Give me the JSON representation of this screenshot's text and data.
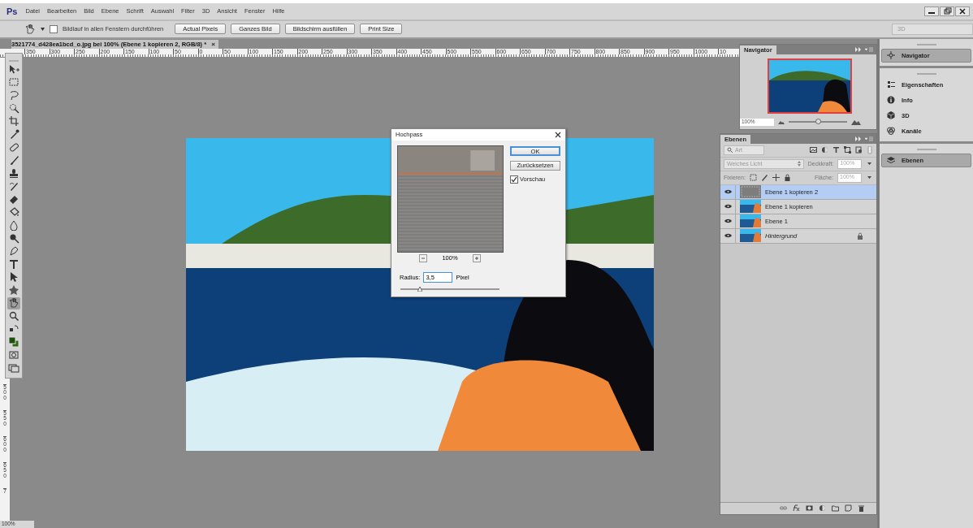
{
  "app": {
    "logo": "Ps"
  },
  "menu": [
    "Datei",
    "Bearbeiten",
    "Bild",
    "Ebene",
    "Schrift",
    "Auswahl",
    "Filter",
    "3D",
    "Ansicht",
    "Fenster",
    "Hilfe"
  ],
  "options_bar": {
    "scroll_all": {
      "label": "Bildlauf in allen Fenstern durchführen",
      "checked": false
    },
    "buttons": [
      "Actual Pixels",
      "Ganzes Bild",
      "Bildschirm ausfüllen",
      "Print Size"
    ],
    "workspace": "3D"
  },
  "document": {
    "tab_title": "3521774_d428ea1bcd_o.jpg bei 100% (Ebene 1 kopieren 2, RGB/8) *",
    "tab_close": "×"
  },
  "rulers": {
    "horizontal": [
      "350",
      "300",
      "250",
      "200",
      "150",
      "100",
      "50",
      "0",
      "50",
      "100",
      "150",
      "200",
      "250",
      "300",
      "350",
      "400",
      "450",
      "500",
      "550",
      "600",
      "650",
      "700",
      "750",
      "800",
      "850",
      "900",
      "950",
      "1000",
      "10"
    ],
    "vertical": [
      "500",
      "550",
      "600",
      "650",
      "7"
    ]
  },
  "tools": [
    {
      "kind": "move",
      "selected": false
    },
    {
      "kind": "marquee",
      "selected": false
    },
    {
      "kind": "lasso",
      "selected": false
    },
    {
      "kind": "quickselect",
      "selected": false
    },
    {
      "kind": "crop",
      "selected": false
    },
    {
      "kind": "eyedropper",
      "selected": false
    },
    {
      "kind": "healing",
      "selected": false
    },
    {
      "kind": "brush",
      "selected": false
    },
    {
      "kind": "stamp",
      "selected": false
    },
    {
      "kind": "history",
      "selected": false
    },
    {
      "kind": "eraser",
      "selected": false
    },
    {
      "kind": "bucket",
      "selected": false
    },
    {
      "kind": "blur",
      "selected": false
    },
    {
      "kind": "dodge",
      "selected": false
    },
    {
      "kind": "pen",
      "selected": false
    },
    {
      "kind": "type",
      "selected": false
    },
    {
      "kind": "pathselect",
      "selected": false
    },
    {
      "kind": "shape",
      "selected": false
    },
    {
      "kind": "hand",
      "selected": true
    },
    {
      "kind": "zoom",
      "selected": false
    },
    {
      "kind": "swap",
      "selected": false
    },
    {
      "kind": "colors",
      "selected": false
    },
    {
      "kind": "quickmask",
      "selected": false
    },
    {
      "kind": "screenmode",
      "selected": false
    }
  ],
  "dialog": {
    "title": "Hochpass",
    "zoom": "100%",
    "radius_label": "Radius:",
    "radius_value": "3,5",
    "radius_unit": "Pixel",
    "slider": {
      "level": 0.2
    },
    "buttons": [
      {
        "label": "OK",
        "default": true
      },
      {
        "label": "Zurücksetzen",
        "default": false
      }
    ],
    "preview": {
      "label": "Vorschau",
      "checked": true
    }
  },
  "navigator": {
    "title": "Navigator",
    "zoom": "100%",
    "slider": {
      "level": 0.5
    }
  },
  "layers_panel": {
    "title": "Ebenen",
    "filter": "Art",
    "blend_mode": "Weiches Licht",
    "opacity_label": "Deckkraft:",
    "opacity": "100%",
    "lock_label": "Fixieren:",
    "fill_label": "Fläche:",
    "fill": "100%",
    "layers": [
      {
        "name": "Ebene 1 kopieren 2",
        "kind": "filtered",
        "selected": true,
        "visible": true,
        "locked": false
      },
      {
        "name": "Ebene 1 kopieren",
        "kind": "layer",
        "selected": false,
        "visible": true,
        "locked": false
      },
      {
        "name": "Ebene 1",
        "kind": "layer",
        "selected": false,
        "visible": true,
        "locked": false
      },
      {
        "name": "Hintergrund",
        "kind": "background",
        "selected": false,
        "visible": true,
        "locked": true
      }
    ]
  },
  "dock": [
    {
      "items": [
        {
          "label": "Navigator",
          "kind": "navigator",
          "selected": true
        }
      ]
    },
    {
      "items": [
        {
          "label": "Eigenschaften",
          "kind": "properties",
          "selected": false
        },
        {
          "label": "Info",
          "kind": "info",
          "selected": false
        },
        {
          "label": "3D",
          "kind": "cube",
          "selected": false
        },
        {
          "label": "Kanäle",
          "kind": "channels",
          "selected": false
        }
      ]
    },
    {
      "items": [
        {
          "label": "Ebenen",
          "kind": "layers",
          "selected": true
        }
      ]
    }
  ],
  "status_bar": {
    "zoom": "100%"
  }
}
